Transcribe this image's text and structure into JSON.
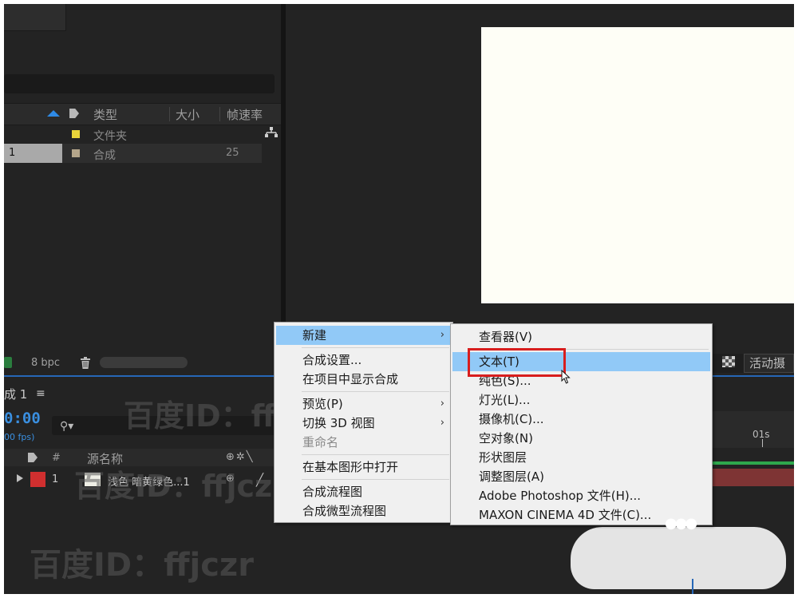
{
  "project": {
    "columns": [
      "类型",
      "大小",
      "帧速率"
    ],
    "rows": [
      {
        "name": "",
        "type": "文件夹",
        "fps": "",
        "color": "#e8d33a"
      },
      {
        "name": "1",
        "type": "合成",
        "fps": "25",
        "color": "#b4a58a"
      }
    ],
    "bpc": "8 bpc"
  },
  "viewer": {
    "active_camera": "活动摄"
  },
  "timeline": {
    "comp_tab": "成 1",
    "menu_glyph": "≡",
    "timecode": "0:00",
    "fps": "00 fps)",
    "search_icon": "⚲▾",
    "header": {
      "hash": "#",
      "source_name": "源名称",
      "switches": "⊕✲╲"
    },
    "layer": {
      "num": "1",
      "name": "浅色 暗黄绿色...1",
      "color": "#d02f2f"
    },
    "ruler_label": "01s"
  },
  "watermark": "百度ID：ffjczr",
  "context_menu": {
    "items": [
      {
        "label": "新建",
        "submenu": true,
        "highlighted": true
      },
      {
        "label": "合成设置..."
      },
      {
        "label": "在项目中显示合成"
      },
      {
        "label": "预览(P)",
        "submenu": true
      },
      {
        "label": "切换 3D 视图",
        "submenu": true
      },
      {
        "label": "重命名",
        "disabled": true
      },
      {
        "label": "在基本图形中打开"
      },
      {
        "label": "合成流程图"
      },
      {
        "label": "合成微型流程图"
      }
    ],
    "submenu_arrow": "›"
  },
  "new_submenu": {
    "items": [
      {
        "label": "查看器(V)"
      },
      {
        "label": "文本(T)",
        "highlighted": true
      },
      {
        "label": "纯色(S)..."
      },
      {
        "label": "灯光(L)..."
      },
      {
        "label": "摄像机(C)..."
      },
      {
        "label": "空对象(N)"
      },
      {
        "label": "形状图层"
      },
      {
        "label": "调整图层(A)"
      },
      {
        "label": "Adobe Photoshop 文件(H)..."
      },
      {
        "label": "MAXON CINEMA 4D 文件(C)..."
      }
    ]
  },
  "colors": {
    "accent": "#2e8ae6",
    "highlight": "#91c9f7",
    "annotation_red": "#d81e1e",
    "canvas": "#fefef6"
  }
}
